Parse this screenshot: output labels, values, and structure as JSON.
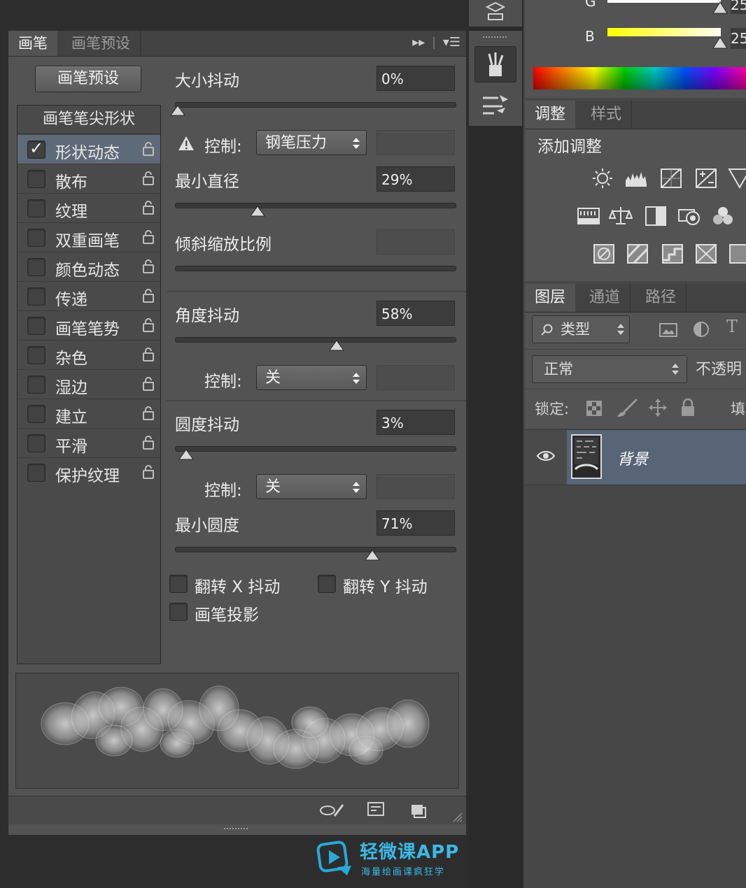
{
  "brush_panel": {
    "tabs": [
      {
        "label": "画笔",
        "active": true
      },
      {
        "label": "画笔预设",
        "active": false
      }
    ],
    "presets_button": "画笔预设",
    "tip_shape_header": "画笔笔尖形状",
    "options": [
      {
        "label": "形状动态",
        "checked": true,
        "selected": true
      },
      {
        "label": "散布",
        "checked": false
      },
      {
        "label": "纹理",
        "checked": false
      },
      {
        "label": "双重画笔",
        "checked": false
      },
      {
        "label": "颜色动态",
        "checked": false
      },
      {
        "label": "传递",
        "checked": false
      },
      {
        "label": "画笔笔势",
        "checked": false
      },
      {
        "label": "杂色",
        "checked": false
      },
      {
        "label": "湿边",
        "checked": false
      },
      {
        "label": "建立",
        "checked": false
      },
      {
        "label": "平滑",
        "checked": false
      },
      {
        "label": "保护纹理",
        "checked": false
      }
    ],
    "size_jitter": {
      "label": "大小抖动",
      "value": "0%",
      "fraction": 0.0
    },
    "control_1": {
      "label": "控制:",
      "value": "钢笔压力"
    },
    "min_diameter": {
      "label": "最小直径",
      "value": "29%",
      "fraction": 0.29
    },
    "tilt_scale": {
      "label": "倾斜缩放比例",
      "value": ""
    },
    "angle_jitter": {
      "label": "角度抖动",
      "value": "58%",
      "fraction": 0.58
    },
    "control_2": {
      "label": "控制:",
      "value": "关"
    },
    "roundness_jitter": {
      "label": "圆度抖动",
      "value": "3%",
      "fraction": 0.03
    },
    "control_3": {
      "label": "控制:",
      "value": "关"
    },
    "min_roundness": {
      "label": "最小圆度",
      "value": "71%",
      "fraction": 0.71
    },
    "flip_x": {
      "label": "翻转 X 抖动",
      "checked": false
    },
    "flip_y": {
      "label": "翻转 Y 抖动",
      "checked": false
    },
    "brush_projection": {
      "label": "画笔投影",
      "checked": false
    }
  },
  "color_panel": {
    "g_label": "G",
    "b_label": "B",
    "g_value": "25",
    "b_value": "25"
  },
  "adjust_panel": {
    "tabs": [
      {
        "label": "调整",
        "active": true
      },
      {
        "label": "样式",
        "active": false
      }
    ],
    "title": "添加调整"
  },
  "layers_panel": {
    "tabs": [
      {
        "label": "图层",
        "active": true
      },
      {
        "label": "通道",
        "active": false
      },
      {
        "label": "路径",
        "active": false
      }
    ],
    "filter_label": "类型",
    "filter_icons": [
      "image-filter-icon",
      "adjustment-filter-icon",
      "type-filter-icon"
    ],
    "blend_mode": "正常",
    "opacity_label": "不透明",
    "lock_label": "锁定:",
    "fill_label": "填",
    "layer": {
      "name": "背景",
      "visible": true
    }
  },
  "watermark": {
    "title": "轻微课APP",
    "subtitle": "海量绘画课疯狂学"
  },
  "colors": {
    "panel_bg": "#535353",
    "selected_row": "#5e6a78",
    "selected_layer": "#576577",
    "accent_blue": "#2aa8d8"
  }
}
